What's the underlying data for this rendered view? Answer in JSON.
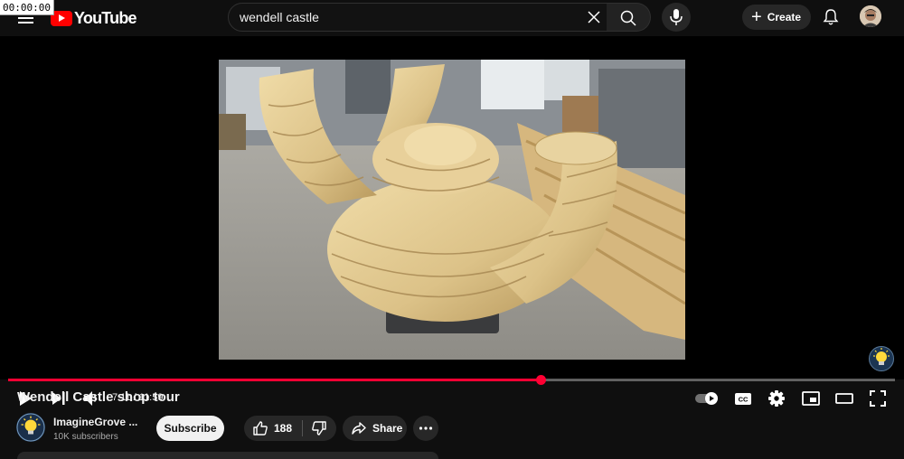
{
  "timestamp": "00:00:00",
  "header": {
    "logo_text": "YouTube",
    "search_value": "wendell castle",
    "create_label": "Create"
  },
  "player": {
    "time_current": "7:11",
    "time_separator": " / ",
    "time_total": "11:59",
    "progress_fraction": 0.6,
    "autoplay_on": true
  },
  "video": {
    "title": "Wendell Castle shop tour",
    "channel_name": "ImagineGrove ...",
    "subscribers": "10K subscribers",
    "subscribe_label": "Subscribe",
    "likes": "188",
    "share_label": "Share"
  },
  "colors": {
    "accent": "#ff0033",
    "background": "#0f0f0f",
    "button_bg": "#272727"
  }
}
